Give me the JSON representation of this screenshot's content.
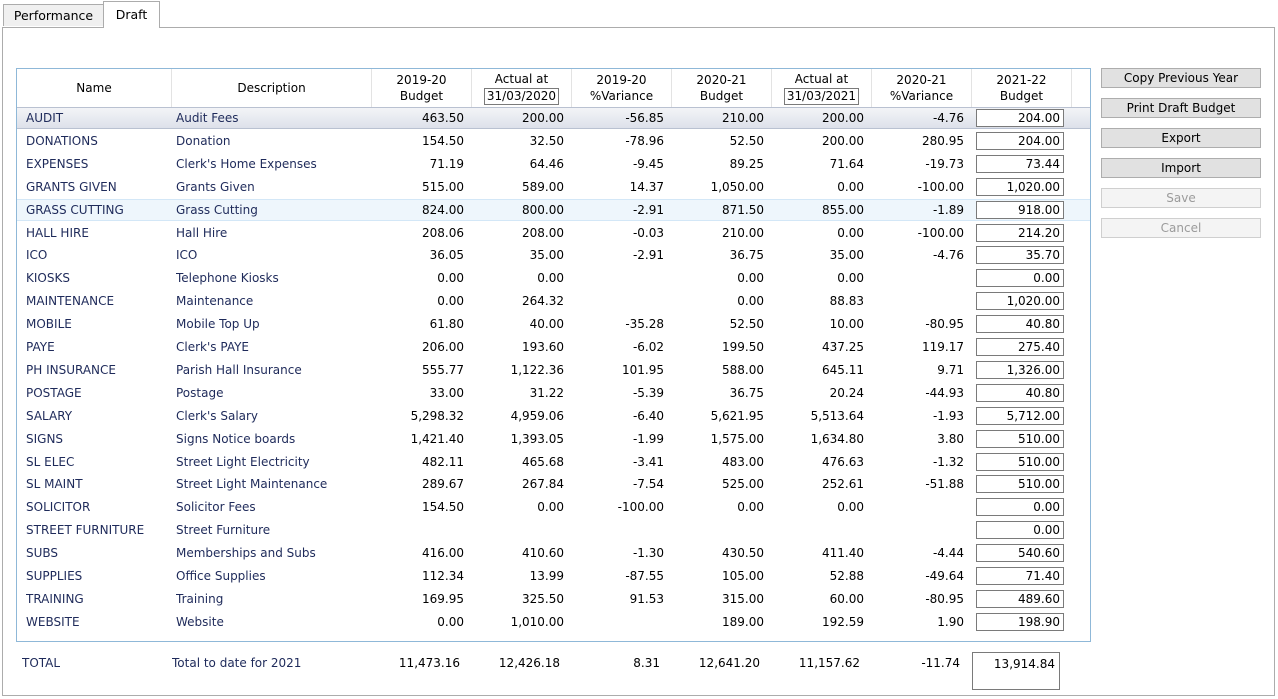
{
  "tabs": [
    {
      "label": "Performance"
    },
    {
      "label": "Draft"
    }
  ],
  "columns": {
    "name": [
      "Name"
    ],
    "description": [
      "Description"
    ],
    "b19": [
      "2019-20",
      "Budget"
    ],
    "a20": [
      "Actual at",
      "31/03/2020"
    ],
    "v19": [
      "2019-20",
      "%Variance"
    ],
    "b20": [
      "2020-21",
      "Budget"
    ],
    "a21": [
      "Actual at",
      "31/03/2021"
    ],
    "v20": [
      "2020-21",
      "%Variance"
    ],
    "b22": [
      "2021-22",
      "Budget"
    ]
  },
  "rows": [
    {
      "name": "AUDIT",
      "desc": "Audit Fees",
      "b19": "463.50",
      "a20": "200.00",
      "v19": "-56.85",
      "b20": "210.00",
      "a21": "200.00",
      "v20": "-4.76",
      "b22": "204.00"
    },
    {
      "name": "DONATIONS",
      "desc": "Donation",
      "b19": "154.50",
      "a20": "32.50",
      "v19": "-78.96",
      "b20": "52.50",
      "a21": "200.00",
      "v20": "280.95",
      "b22": "204.00"
    },
    {
      "name": "EXPENSES",
      "desc": "Clerk's Home Expenses",
      "b19": "71.19",
      "a20": "64.46",
      "v19": "-9.45",
      "b20": "89.25",
      "a21": "71.64",
      "v20": "-19.73",
      "b22": "73.44"
    },
    {
      "name": "GRANTS GIVEN",
      "desc": "Grants Given",
      "b19": "515.00",
      "a20": "589.00",
      "v19": "14.37",
      "b20": "1,050.00",
      "a21": "0.00",
      "v20": "-100.00",
      "b22": "1,020.00"
    },
    {
      "name": "GRASS CUTTING",
      "desc": "Grass Cutting",
      "b19": "824.00",
      "a20": "800.00",
      "v19": "-2.91",
      "b20": "871.50",
      "a21": "855.00",
      "v20": "-1.89",
      "b22": "918.00"
    },
    {
      "name": "HALL HIRE",
      "desc": "Hall Hire",
      "b19": "208.06",
      "a20": "208.00",
      "v19": "-0.03",
      "b20": "210.00",
      "a21": "0.00",
      "v20": "-100.00",
      "b22": "214.20"
    },
    {
      "name": "ICO",
      "desc": "ICO",
      "b19": "36.05",
      "a20": "35.00",
      "v19": "-2.91",
      "b20": "36.75",
      "a21": "35.00",
      "v20": "-4.76",
      "b22": "35.70"
    },
    {
      "name": "KIOSKS",
      "desc": "Telephone Kiosks",
      "b19": "0.00",
      "a20": "0.00",
      "v19": "",
      "b20": "0.00",
      "a21": "0.00",
      "v20": "",
      "b22": "0.00"
    },
    {
      "name": "MAINTENANCE",
      "desc": "Maintenance",
      "b19": "0.00",
      "a20": "264.32",
      "v19": "",
      "b20": "0.00",
      "a21": "88.83",
      "v20": "",
      "b22": "1,020.00"
    },
    {
      "name": "MOBILE",
      "desc": "Mobile Top Up",
      "b19": "61.80",
      "a20": "40.00",
      "v19": "-35.28",
      "b20": "52.50",
      "a21": "10.00",
      "v20": "-80.95",
      "b22": "40.80"
    },
    {
      "name": "PAYE",
      "desc": "Clerk's PAYE",
      "b19": "206.00",
      "a20": "193.60",
      "v19": "-6.02",
      "b20": "199.50",
      "a21": "437.25",
      "v20": "119.17",
      "b22": "275.40"
    },
    {
      "name": "PH INSURANCE",
      "desc": "Parish Hall Insurance",
      "b19": "555.77",
      "a20": "1,122.36",
      "v19": "101.95",
      "b20": "588.00",
      "a21": "645.11",
      "v20": "9.71",
      "b22": "1,326.00"
    },
    {
      "name": "POSTAGE",
      "desc": "Postage",
      "b19": "33.00",
      "a20": "31.22",
      "v19": "-5.39",
      "b20": "36.75",
      "a21": "20.24",
      "v20": "-44.93",
      "b22": "40.80"
    },
    {
      "name": "SALARY",
      "desc": "Clerk's Salary",
      "b19": "5,298.32",
      "a20": "4,959.06",
      "v19": "-6.40",
      "b20": "5,621.95",
      "a21": "5,513.64",
      "v20": "-1.93",
      "b22": "5,712.00"
    },
    {
      "name": "SIGNS",
      "desc": "Signs Notice boards",
      "b19": "1,421.40",
      "a20": "1,393.05",
      "v19": "-1.99",
      "b20": "1,575.00",
      "a21": "1,634.80",
      "v20": "3.80",
      "b22": "510.00"
    },
    {
      "name": "SL ELEC",
      "desc": "Street Light Electricity",
      "b19": "482.11",
      "a20": "465.68",
      "v19": "-3.41",
      "b20": "483.00",
      "a21": "476.63",
      "v20": "-1.32",
      "b22": "510.00"
    },
    {
      "name": "SL MAINT",
      "desc": "Street Light Maintenance",
      "b19": "289.67",
      "a20": "267.84",
      "v19": "-7.54",
      "b20": "525.00",
      "a21": "252.61",
      "v20": "-51.88",
      "b22": "510.00"
    },
    {
      "name": "SOLICITOR",
      "desc": "Solicitor Fees",
      "b19": "154.50",
      "a20": "0.00",
      "v19": "-100.00",
      "b20": "0.00",
      "a21": "0.00",
      "v20": "",
      "b22": "0.00"
    },
    {
      "name": "STREET FURNITURE",
      "desc": "Street Furniture",
      "b19": "",
      "a20": "",
      "v19": "",
      "b20": "",
      "a21": "",
      "v20": "",
      "b22": "0.00"
    },
    {
      "name": "SUBS",
      "desc": "Memberships and Subs",
      "b19": "416.00",
      "a20": "410.60",
      "v19": "-1.30",
      "b20": "430.50",
      "a21": "411.40",
      "v20": "-4.44",
      "b22": "540.60"
    },
    {
      "name": "SUPPLIES",
      "desc": "Office Supplies",
      "b19": "112.34",
      "a20": "13.99",
      "v19": "-87.55",
      "b20": "105.00",
      "a21": "52.88",
      "v20": "-49.64",
      "b22": "71.40"
    },
    {
      "name": "TRAINING",
      "desc": "Training",
      "b19": "169.95",
      "a20": "325.50",
      "v19": "91.53",
      "b20": "315.00",
      "a21": "60.00",
      "v20": "-80.95",
      "b22": "489.60"
    },
    {
      "name": "WEBSITE",
      "desc": "Website",
      "b19": "0.00",
      "a20": "1,010.00",
      "v19": "",
      "b20": "189.00",
      "a21": "192.59",
      "v20": "1.90",
      "b22": "198.90"
    }
  ],
  "total": {
    "name": "TOTAL",
    "desc": "Total to date for 2021",
    "b19": "11,473.16",
    "a20": "12,426.18",
    "v19": "8.31",
    "b20": "12,641.20",
    "a21": "11,157.62",
    "v20": "-11.74",
    "b22": "13,914.84"
  },
  "buttons": [
    {
      "label": "Copy Previous Year",
      "enabled": true
    },
    {
      "label": "Print Draft Budget",
      "enabled": true
    },
    {
      "label": "Export",
      "enabled": true
    },
    {
      "label": "Import",
      "enabled": true
    },
    {
      "label": "Save",
      "enabled": false
    },
    {
      "label": "Cancel",
      "enabled": false
    }
  ],
  "selected_row": "AUDIT",
  "hovered_row": "GRASS CUTTING"
}
